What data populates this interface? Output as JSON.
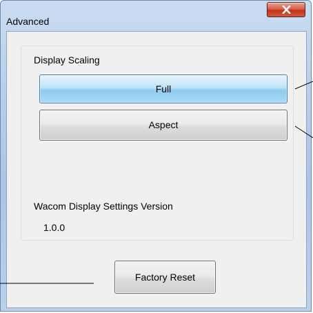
{
  "window": {
    "title": "Advanced",
    "close_glyph": "close-icon"
  },
  "display_scaling": {
    "label": "Display Scaling",
    "options": [
      {
        "label": "Full",
        "selected": true
      },
      {
        "label": "Aspect",
        "selected": false
      }
    ]
  },
  "version": {
    "label": "Wacom Display Settings Version",
    "value": "1.0.0"
  },
  "actions": {
    "factory_reset_label": "Factory Reset"
  },
  "colors": {
    "selected_button": "#bfe3f8",
    "close_button": "#c2321c",
    "frame": "#b7cfea"
  }
}
